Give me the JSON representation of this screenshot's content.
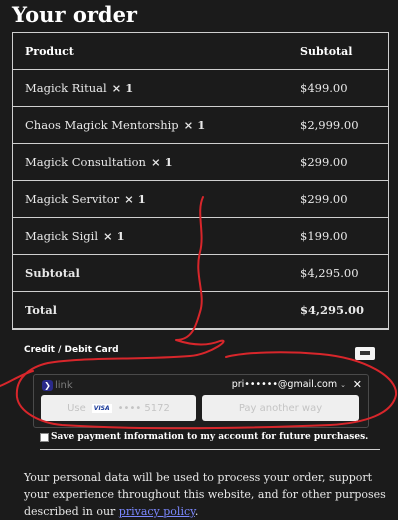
{
  "page": {
    "title": "Your order"
  },
  "table": {
    "headers": {
      "product": "Product",
      "subtotal": "Subtotal"
    },
    "items": [
      {
        "name": "Magick Ritual",
        "qty": "× 1",
        "price": "$499.00"
      },
      {
        "name": "Chaos Magick Mentorship",
        "qty": "× 1",
        "price": "$2,999.00"
      },
      {
        "name": "Magick Consultation",
        "qty": "× 1",
        "price": "$299.00"
      },
      {
        "name": "Magick Servitor",
        "qty": "× 1",
        "price": "$299.00"
      },
      {
        "name": "Magick Sigil",
        "qty": "× 1",
        "price": "$199.00"
      }
    ],
    "subtotal": {
      "label": "Subtotal",
      "value": "$4,295.00"
    },
    "total": {
      "label": "Total",
      "value": "$4,295.00"
    }
  },
  "payment": {
    "method_label": "Credit / Debit Card",
    "link": {
      "logo_text": "link",
      "email": "pri••••••@gmail.com",
      "use_label": "Use",
      "card_brand": "VISA",
      "card_last4": "•••• 5172",
      "pay_another": "Pay another way"
    },
    "save_label": "Save payment information to my account for future purchases."
  },
  "privacy": {
    "text": "Your personal data will be used to process your order, support your experience throughout this website, and for other purposes described in our ",
    "link_text": "privacy policy",
    "end": "."
  },
  "colors": {
    "background": "#1b1b1b",
    "annotation": "#d8262b",
    "link": "#7b88ff"
  }
}
